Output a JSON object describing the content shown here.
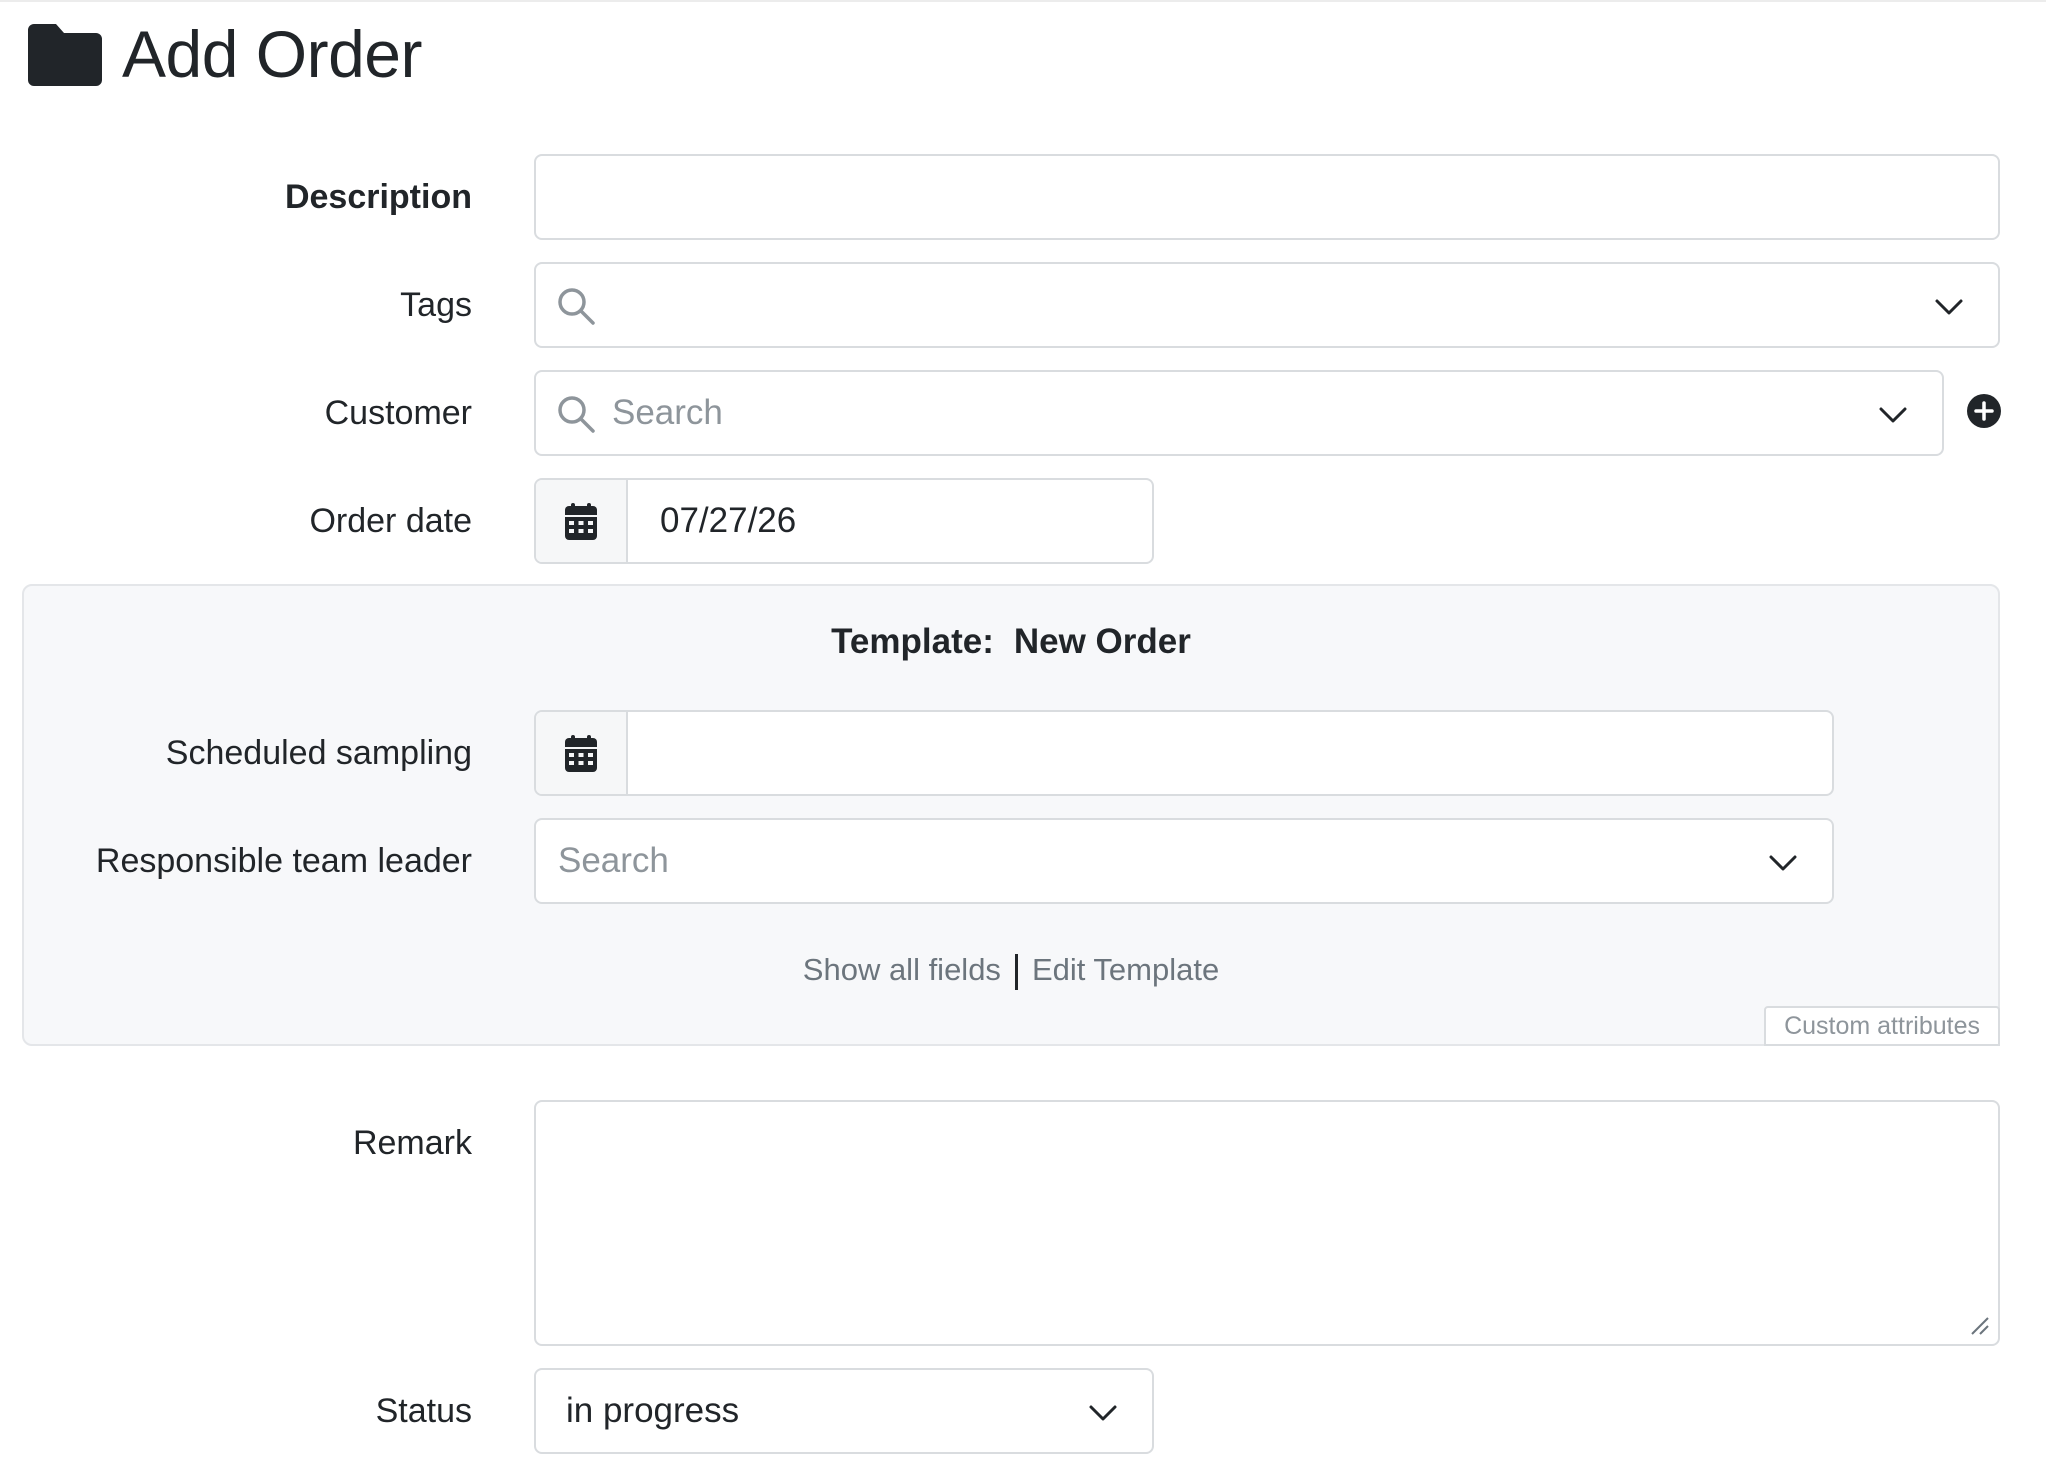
{
  "page": {
    "title": "Add Order",
    "title_icon": "folder-icon"
  },
  "form": {
    "description": {
      "label": "Description",
      "value": ""
    },
    "tags": {
      "label": "Tags",
      "value": "",
      "icons": [
        "search-icon",
        "chevron-down-icon"
      ]
    },
    "customer": {
      "label": "Customer",
      "placeholder": "Search",
      "icons": [
        "search-icon",
        "chevron-down-icon",
        "plus-circle-icon"
      ]
    },
    "order_date": {
      "label": "Order date",
      "value": "07/27/26",
      "icon": "calendar-icon"
    },
    "remark": {
      "label": "Remark",
      "value": ""
    },
    "status": {
      "label": "Status",
      "value": "in progress",
      "icon": "chevron-down-icon"
    }
  },
  "template": {
    "prefix": "Template:",
    "name": "New Order",
    "scheduled_sampling": {
      "label": "Scheduled sampling",
      "value": "",
      "icon": "calendar-icon"
    },
    "team_leader": {
      "label": "Responsible team leader",
      "placeholder": "Search",
      "icon": "chevron-down-icon"
    },
    "show_all_fields": "Show all fields",
    "edit_template": "Edit Template",
    "custom_attributes": "Custom attributes"
  },
  "colors": {
    "border": "#d9dcdf",
    "panel_bg": "#f7f8fa",
    "text": "#212529",
    "muted": "#8e959b"
  }
}
